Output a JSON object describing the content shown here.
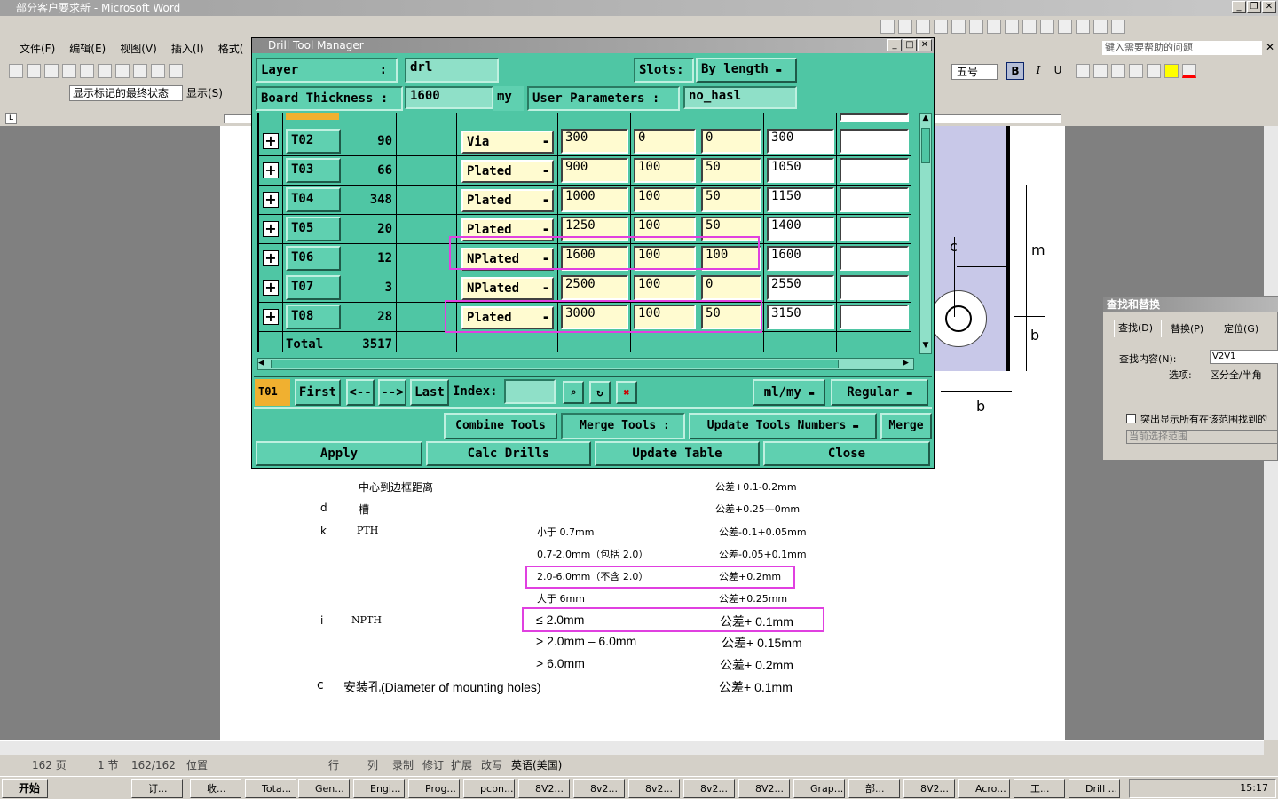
{
  "word": {
    "title": "部分客户要求新 - Microsoft Word",
    "menus": [
      "文件(F)",
      "编辑(E)",
      "视图(V)",
      "插入(I)",
      "格式("
    ],
    "show_markup": "显示标记的最终状态",
    "show_btn": "显示(S)",
    "help_placeholder": "键入需要帮助的问题",
    "font_size": "五号",
    "bold": "B",
    "italic": "I",
    "underline": "U"
  },
  "doc": {
    "rows": [
      {
        "c1": "",
        "c2": "中心到边框距离",
        "c3": "",
        "c4": "公差+0.1-0.2mm"
      },
      {
        "c1": "d",
        "c2": "槽",
        "c3": "",
        "c4": "公差+0.25—0mm"
      },
      {
        "c1": "k",
        "c2": "PTH",
        "c3": "小于 0.7mm",
        "c4": "公差-0.1+0.05mm"
      },
      {
        "c1": "",
        "c2": "",
        "c3": "0.7-2.0mm（包括 2.0）",
        "c4": "公差-0.05+0.1mm"
      },
      {
        "c1": "",
        "c2": "",
        "c3": "2.0-6.0mm（不含 2.0）",
        "c4": "公差+0.2mm"
      },
      {
        "c1": "",
        "c2": "",
        "c3": "大于 6mm",
        "c4": "公差+0.25mm"
      },
      {
        "c1": "i",
        "c2": "NPTH",
        "c3": "≤ 2.0mm",
        "c4": "公差+ 0.1mm"
      },
      {
        "c1": "",
        "c2": "",
        "c3": "> 2.0mm – 6.0mm",
        "c4": "公差+ 0.15mm"
      },
      {
        "c1": "",
        "c2": "",
        "c3": "> 6.0mm",
        "c4": "公差+ 0.2mm"
      },
      {
        "c1": "c",
        "c2": "安装孔(Diameter of mounting holes)",
        "c3": "",
        "c4": "公差+ 0.1mm"
      }
    ],
    "diagram_labels": {
      "c": "c",
      "m": "m",
      "b1": "b",
      "b2": "b"
    }
  },
  "dialog": {
    "title": "Drill Tool Manager",
    "layer_label": "Layer",
    "layer_colon": ":",
    "layer_value": "drl",
    "slots_label": "Slots:",
    "slots_value": "By length",
    "board_label": "Board Thickness  :",
    "board_value": "1600",
    "board_unit": "my",
    "user_params_label": "User Parameters  :",
    "user_params_value": "no_hasl",
    "tools": [
      {
        "name": "T02",
        "count": "90",
        "type": "Via",
        "v1": "300",
        "v2": "0",
        "v3": "0",
        "v4": "300"
      },
      {
        "name": "T03",
        "count": "66",
        "type": "Plated",
        "v1": "900",
        "v2": "100",
        "v3": "50",
        "v4": "1050"
      },
      {
        "name": "T04",
        "count": "348",
        "type": "Plated",
        "v1": "1000",
        "v2": "100",
        "v3": "50",
        "v4": "1150"
      },
      {
        "name": "T05",
        "count": "20",
        "type": "Plated",
        "v1": "1250",
        "v2": "100",
        "v3": "50",
        "v4": "1400"
      },
      {
        "name": "T06",
        "count": "12",
        "type": "NPlated",
        "v1": "1600",
        "v2": "100",
        "v3": "100",
        "v4": "1600"
      },
      {
        "name": "T07",
        "count": "3",
        "type": "NPlated",
        "v1": "2500",
        "v2": "100",
        "v3": "0",
        "v4": "2550"
      },
      {
        "name": "T08",
        "count": "28",
        "type": "Plated",
        "v1": "3000",
        "v2": "100",
        "v3": "50",
        "v4": "3150"
      }
    ],
    "total_label": "Total",
    "total_value": "3517",
    "current_tool": "T01",
    "nav": {
      "first": "First",
      "prev": "<--",
      "next": "-->",
      "last": "Last",
      "index": "Index:"
    },
    "units": "ml/my",
    "mode": "Regular",
    "combine": "Combine Tools",
    "merge_label": "Merge Tools  :",
    "merge_option": "Update Tools Numbers",
    "merge": "Merge",
    "apply": "Apply",
    "calc": "Calc Drills",
    "update": "Update Table",
    "close": "Close"
  },
  "find": {
    "title": "查找和替换",
    "tabs": [
      "查找(D)",
      "替换(P)",
      "定位(G)"
    ],
    "find_label": "查找内容(N):",
    "find_value": "V2V1",
    "options_label": "选项:",
    "options_value": "区分全/半角",
    "highlight": "突出显示所有在该范围找到的",
    "range": "当前选择范围"
  },
  "status": {
    "page": "162 页",
    "section": "1 节",
    "pos": "162/162",
    "at": "位置",
    "line": "行",
    "col": "列",
    "rec": "录制",
    "trk": "修订",
    "ext": "扩展",
    "ovr": "改写",
    "lang": "英语(美国)"
  },
  "taskbar": {
    "start": "开始",
    "tasks": [
      "订...",
      "收...",
      "Tota...",
      "Gen...",
      "Engi...",
      "Prog...",
      "pcbn...",
      "8V2...",
      "8v2...",
      "8v2...",
      "8v2...",
      "8V2...",
      "Grap...",
      "部...",
      "8V2...",
      "Acro...",
      "工...",
      "Drill ..."
    ],
    "clock": "15:17"
  },
  "colors": {
    "dialog": "#4fc6a4",
    "highlight": "#e040e0",
    "cell": "#fffbd0"
  }
}
